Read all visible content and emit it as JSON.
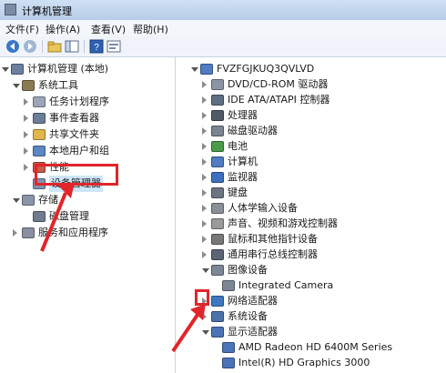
{
  "window": {
    "title": "计算机管理"
  },
  "menu": [
    "文件(F)",
    "操作(A)",
    "查看(V)",
    "帮助(H)"
  ],
  "left_tree": [
    {
      "label": "计算机管理 (本地)",
      "level": 0,
      "state": "open",
      "icon": "computer-management-icon"
    },
    {
      "label": "系统工具",
      "level": 1,
      "state": "open",
      "icon": "tools-icon"
    },
    {
      "label": "任务计划程序",
      "level": 2,
      "state": "closed",
      "icon": "clock-icon"
    },
    {
      "label": "事件查看器",
      "level": 2,
      "state": "closed",
      "icon": "event-viewer-icon"
    },
    {
      "label": "共享文件夹",
      "level": 2,
      "state": "closed",
      "icon": "shared-folder-icon"
    },
    {
      "label": "本地用户和组",
      "level": 2,
      "state": "closed",
      "icon": "users-icon"
    },
    {
      "label": "性能",
      "level": 2,
      "state": "closed",
      "icon": "performance-icon"
    },
    {
      "label": "设备管理器",
      "level": 2,
      "state": "none",
      "icon": "device-manager-icon",
      "selected": true
    },
    {
      "label": "存储",
      "level": 1,
      "state": "open",
      "icon": "storage-icon"
    },
    {
      "label": "磁盘管理",
      "level": 2,
      "state": "none",
      "icon": "disk-icon"
    },
    {
      "label": "服务和应用程序",
      "level": 1,
      "state": "closed",
      "icon": "services-icon"
    }
  ],
  "right_tree": [
    {
      "label": "FVZFGJKUQ3QVLVD",
      "level": 0,
      "state": "open",
      "icon": "computer-icon"
    },
    {
      "label": "DVD/CD-ROM 驱动器",
      "level": 1,
      "state": "closed",
      "icon": "dvd-icon"
    },
    {
      "label": "IDE ATA/ATAPI 控制器",
      "level": 1,
      "state": "closed",
      "icon": "ide-controller-icon"
    },
    {
      "label": "处理器",
      "level": 1,
      "state": "closed",
      "icon": "processor-icon"
    },
    {
      "label": "磁盘驱动器",
      "level": 1,
      "state": "closed",
      "icon": "disk-drive-icon"
    },
    {
      "label": "电池",
      "level": 1,
      "state": "closed",
      "icon": "battery-icon"
    },
    {
      "label": "计算机",
      "level": 1,
      "state": "closed",
      "icon": "computer-icon"
    },
    {
      "label": "监视器",
      "level": 1,
      "state": "closed",
      "icon": "monitor-icon"
    },
    {
      "label": "键盘",
      "level": 1,
      "state": "closed",
      "icon": "keyboard-icon"
    },
    {
      "label": "人体学输入设备",
      "level": 1,
      "state": "closed",
      "icon": "hid-icon"
    },
    {
      "label": "声音、视频和游戏控制器",
      "level": 1,
      "state": "closed",
      "icon": "sound-icon"
    },
    {
      "label": "鼠标和其他指针设备",
      "level": 1,
      "state": "closed",
      "icon": "mouse-icon"
    },
    {
      "label": "通用串行总线控制器",
      "level": 1,
      "state": "closed",
      "icon": "usb-icon"
    },
    {
      "label": "图像设备",
      "level": 1,
      "state": "open",
      "icon": "camera-icon"
    },
    {
      "label": "Integrated Camera",
      "level": 2,
      "state": "none",
      "icon": "camera-icon"
    },
    {
      "label": "网络适配器",
      "level": 1,
      "state": "closed",
      "icon": "network-adapter-icon"
    },
    {
      "label": "系统设备",
      "level": 1,
      "state": "closed",
      "icon": "system-devices-icon"
    },
    {
      "label": "显示适配器",
      "level": 1,
      "state": "open",
      "icon": "display-adapter-icon"
    },
    {
      "label": "AMD Radeon HD 6400M Series",
      "level": 2,
      "state": "none",
      "icon": "display-adapter-icon"
    },
    {
      "label": "Intel(R) HD Graphics 3000",
      "level": 2,
      "state": "none",
      "icon": "display-adapter-icon"
    }
  ],
  "colors": {
    "highlight": "#e0252b",
    "selection": "#cde6f7"
  }
}
